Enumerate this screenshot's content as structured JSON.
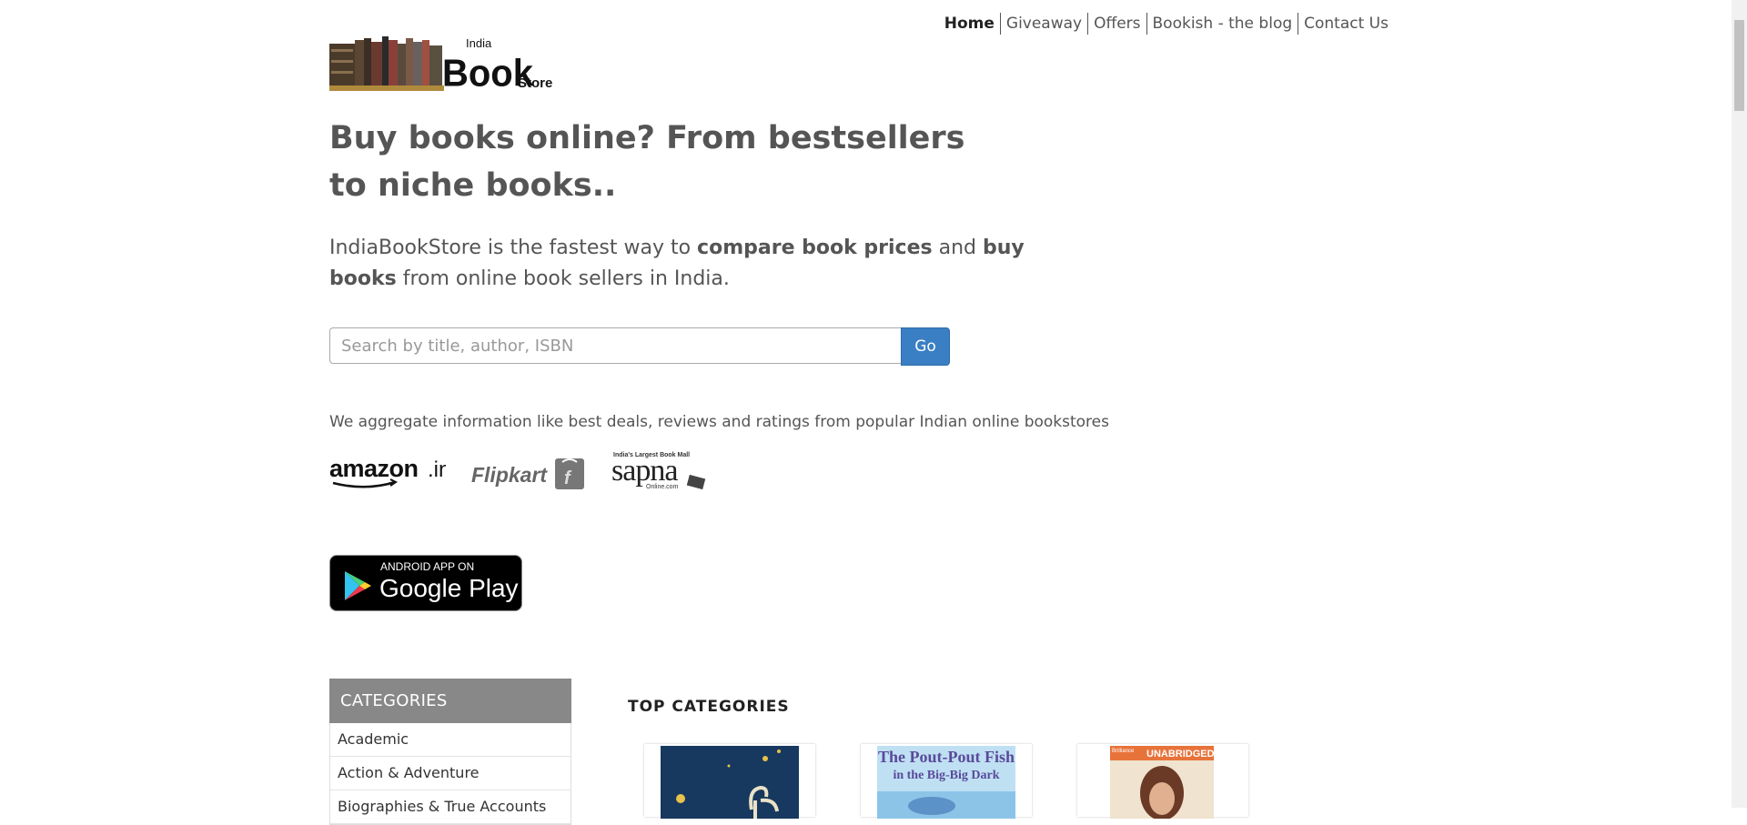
{
  "nav": {
    "items": [
      "Home",
      "Giveaway",
      "Offers",
      "Bookish - the blog",
      "Contact Us"
    ]
  },
  "logo": {
    "line1": "India",
    "line2": "Book",
    "line3": "Store"
  },
  "headline": "Buy books online? From bestsellers to niche books..",
  "lead": {
    "part1": "IndiaBookStore is the fastest way to ",
    "bold1": "compare book prices",
    "part2": " and ",
    "bold2": "buy books",
    "part3": " from online book sellers in India."
  },
  "search": {
    "placeholder": "Search by title, author, ISBN",
    "button": "Go"
  },
  "aggregate": "We aggregate information like best deals, reviews and ratings from popular Indian online bookstores",
  "sellers": {
    "amazon": "amazon",
    "amazon_suffix": ".in",
    "flipkart": "Flipkart",
    "sapna_tag": "India's Largest Book Mall",
    "sapna": "sapna",
    "sapna_suffix": "Online.com"
  },
  "app_badge": {
    "small": "ANDROID APP ON",
    "big": "Google Play"
  },
  "categories": {
    "heading": "CATEGORIES",
    "items": [
      "Academic",
      "Action & Adventure",
      "Biographies & True Accounts"
    ]
  },
  "top_categories": {
    "heading": "TOP CATEGORIES",
    "book2_title1": "The Pout-Pout Fish",
    "book2_title2": "in the Big-Big Dark",
    "book3_banner": "UNABRIDGED",
    "book3_brand": "Brilliance"
  },
  "colors": {
    "accent": "#3a7fc4",
    "category_header": "#888888"
  }
}
